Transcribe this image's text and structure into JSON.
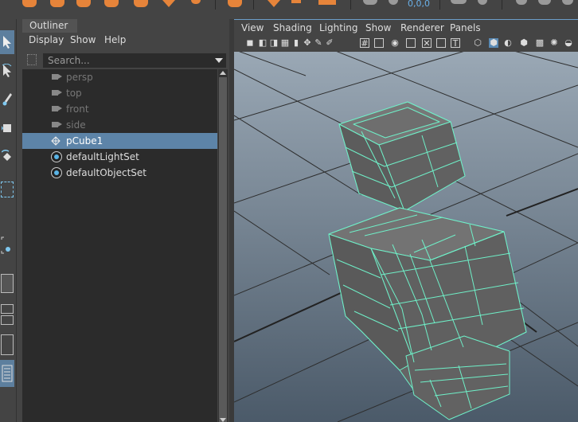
{
  "shelf": {
    "icons": [
      "sphere-icon",
      "cube-icon",
      "cylinder-icon",
      "cone-icon",
      "plane-icon",
      "torus-icon",
      "pipe-icon",
      "text-icon",
      "bevel-icon",
      "camera-icon",
      "snap-icon",
      "coordinate-icon"
    ],
    "coords_text": "0,0,0",
    "accent_color": "#e6843a"
  },
  "toolbox": {
    "tools": [
      "select-tool-icon",
      "lasso-tool-icon",
      "paint-tool-icon",
      "move-tool-icon",
      "rotate-tool-icon",
      "scale-tool-icon",
      "marquee-icon",
      "snap-together-icon",
      "single-pane-layout-icon",
      "two-pane-layout-icon",
      "four-pane-layout-icon",
      "outliner-layout-icon"
    ]
  },
  "outliner": {
    "tab_label": "Outliner",
    "menus": [
      "Display",
      "Show",
      "Help"
    ],
    "search_placeholder": "Search...",
    "items": [
      {
        "label": "persp",
        "type": "camera",
        "dim": true
      },
      {
        "label": "top",
        "type": "camera",
        "dim": true
      },
      {
        "label": "front",
        "type": "camera",
        "dim": true
      },
      {
        "label": "side",
        "type": "camera",
        "dim": true
      },
      {
        "label": "pCube1",
        "type": "mesh",
        "selected": true
      },
      {
        "label": "defaultLightSet",
        "type": "set"
      },
      {
        "label": "defaultObjectSet",
        "type": "set"
      }
    ],
    "selection_color": "#5d84a8"
  },
  "viewport": {
    "menus": [
      "View",
      "Shading",
      "Lighting",
      "Show",
      "Renderer",
      "Panels"
    ],
    "wireframe_color": "#6ff0c8",
    "mesh_color": "#6b6b6b",
    "background_top": "#9aa8b5",
    "background_bottom": "#4b5a69"
  }
}
